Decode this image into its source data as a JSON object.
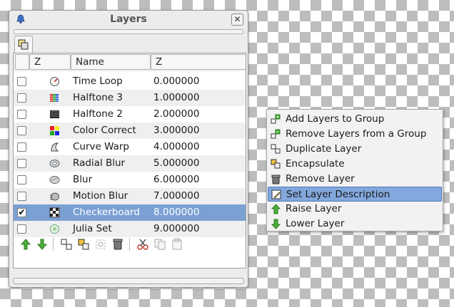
{
  "panel": {
    "title": "Layers",
    "close_glyph": "✕"
  },
  "headers": {
    "active": "Z",
    "name": "Name",
    "z": "Z"
  },
  "layers": [
    {
      "name": "Time Loop",
      "z": "0.000000",
      "checked": false,
      "icon": "time-loop-icon"
    },
    {
      "name": "Halftone 3",
      "z": "1.000000",
      "checked": false,
      "icon": "halftone-3-icon"
    },
    {
      "name": "Halftone 2",
      "z": "2.000000",
      "checked": false,
      "icon": "halftone-2-icon"
    },
    {
      "name": "Color Correct",
      "z": "3.000000",
      "checked": false,
      "icon": "color-correct-icon"
    },
    {
      "name": "Curve Warp",
      "z": "4.000000",
      "checked": false,
      "icon": "curve-warp-icon"
    },
    {
      "name": "Radial Blur",
      "z": "5.000000",
      "checked": false,
      "icon": "radial-blur-icon"
    },
    {
      "name": "Blur",
      "z": "6.000000",
      "checked": false,
      "icon": "blur-icon"
    },
    {
      "name": "Motion Blur",
      "z": "7.000000",
      "checked": false,
      "icon": "motion-blur-icon"
    },
    {
      "name": "Checkerboard",
      "z": "8.000000",
      "checked": true,
      "icon": "checkerboard-icon"
    },
    {
      "name": "Julia Set",
      "z": "9.000000",
      "checked": false,
      "icon": "julia-set-icon"
    }
  ],
  "selected_layer": "Checkerboard",
  "check_glyph": "✔",
  "toolbar": [
    "raise-layer-icon",
    "lower-layer-icon",
    "duplicate-layer-icon",
    "encapsulate-icon",
    "group-icon",
    "remove-layer-icon",
    "cut-icon",
    "copy-icon",
    "paste-icon"
  ],
  "context_menu": {
    "items": [
      {
        "label": "Add Layers to Group",
        "icon": "add-to-group-icon"
      },
      {
        "label": "Remove Layers from a Group",
        "icon": "remove-from-group-icon"
      },
      {
        "label": "Duplicate Layer",
        "icon": "duplicate-layer-icon"
      },
      {
        "label": "Encapsulate",
        "icon": "encapsulate-icon"
      },
      {
        "label": "Remove Layer",
        "icon": "remove-layer-icon"
      },
      {
        "label": "Set Layer Description",
        "icon": "set-description-icon"
      },
      {
        "label": "Raise Layer",
        "icon": "raise-layer-icon"
      },
      {
        "label": "Lower Layer",
        "icon": "lower-layer-icon"
      }
    ],
    "highlighted": "Set Layer Description"
  },
  "colors": {
    "selection": "#7ba0d4",
    "menu_highlight": "#82a8dd",
    "checker": "#bdbdbd"
  }
}
